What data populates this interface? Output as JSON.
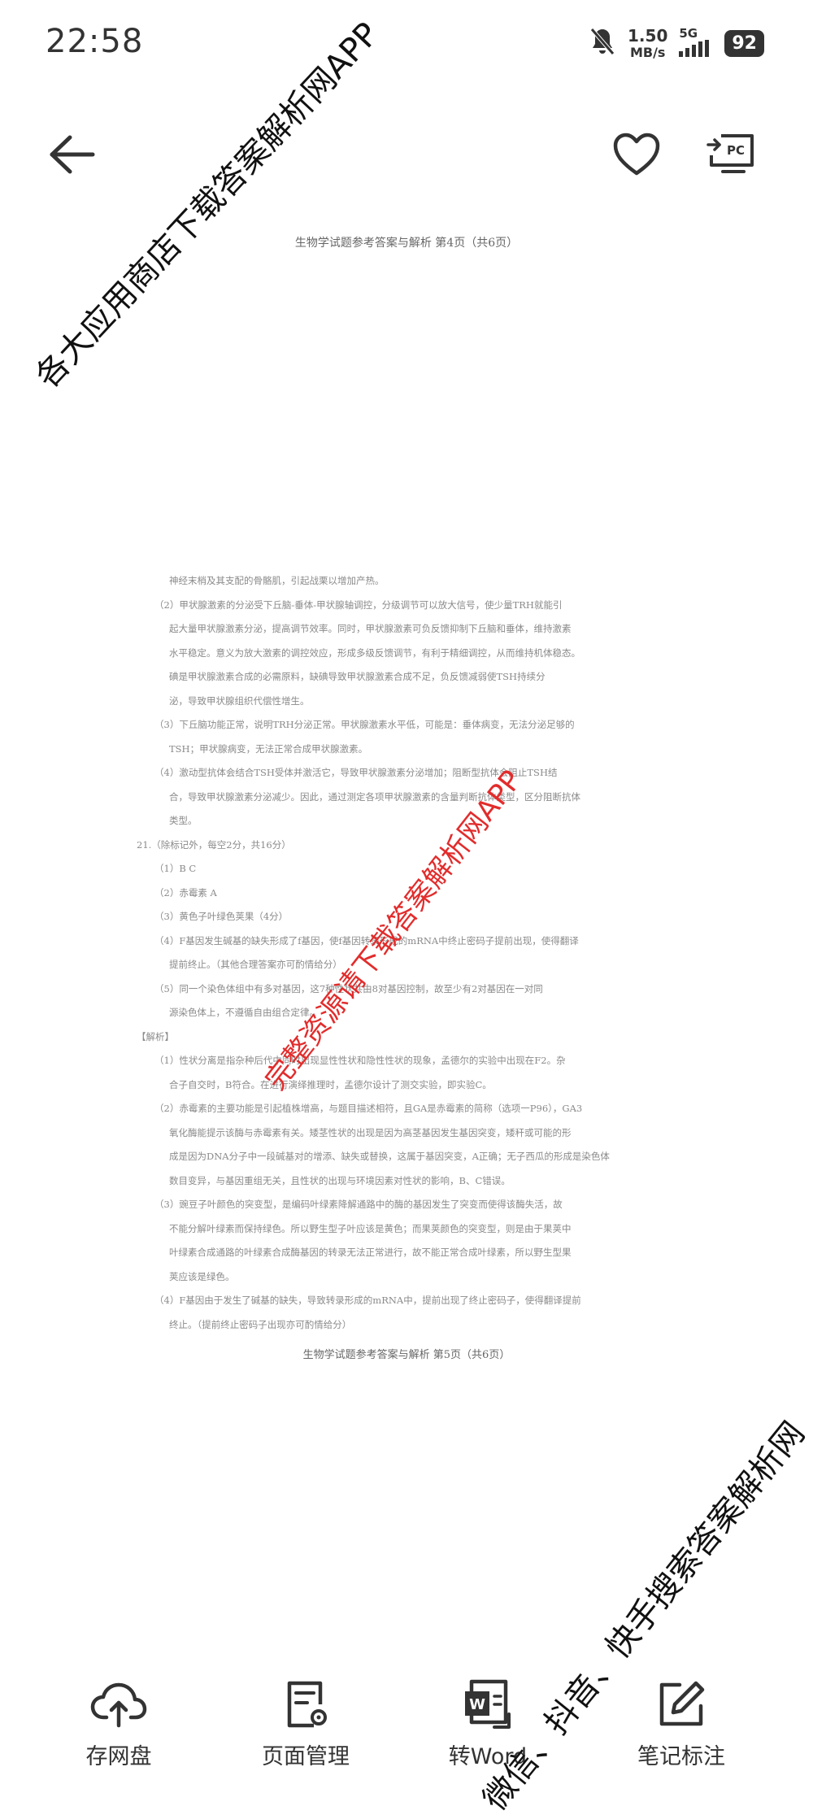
{
  "status_bar": {
    "time": "22:58",
    "speed_value": "1.50",
    "speed_unit": "MB/s",
    "network": "5G",
    "battery": "92",
    "icons": [
      "mute-icon",
      "signal-icon"
    ]
  },
  "app_bar": {
    "icons": [
      "back-arrow-icon",
      "heart-icon",
      "cast-to-pc-icon"
    ],
    "pc_label": "PC"
  },
  "document": {
    "top_caption": "生物学试题参考答案与解析 第4页（共6页）",
    "bottom_caption": "生物学试题参考答案与解析 第5页（共6页）",
    "lines": [
      "神经末梢及其支配的骨骼肌，引起战栗以增加产热。",
      "（2）甲状腺激素的分泌受下丘脑-垂体-甲状腺轴调控，分级调节可以放大信号，使少量TRH就能引",
      "起大量甲状腺激素分泌，提高调节效率。同时，甲状腺激素可负反馈抑制下丘脑和垂体，维持激素",
      "水平稳定。意义为放大激素的调控效应，形成多级反馈调节，有利于精细调控，从而维持机体稳态。",
      "碘是甲状腺激素合成的必需原料，缺碘导致甲状腺激素合成不足，负反馈减弱使TSH持续分",
      "泌，导致甲状腺组织代偿性增生。",
      "（3）下丘脑功能正常，说明TRH分泌正常。甲状腺激素水平低，可能是：垂体病变，无法分泌足够的",
      "TSH；甲状腺病变，无法正常合成甲状腺激素。",
      "（4）激动型抗体会结合TSH受体并激活它，导致甲状腺激素分泌增加；阻断型抗体会阻止TSH结",
      "合，导致甲状腺激素分泌减少。因此，通过测定各项甲状腺激素的含量判断抗体类型，区分阻断抗体",
      "类型。",
      "21.（除标记外，每空2分，共16分）",
      "（1）B C",
      "（2）赤霉素 A",
      "（3）黄色子叶绿色荚果（4分）",
      "（4）F基因发生碱基的缺失形成了f基因，使f基因转录形成的mRNA中终止密码子提前出现，使得翻译",
      "提前终止。（其他合理答案亦可酌情给分）",
      "（5）同一个染色体组中有多对基因，这7种性状共由8对基因控制，故至少有2对基因在一对同",
      "源染色体上，不遵循自由组合定律。",
      "【解析】",
      "（1）性状分离是指杂种后代中同时出现显性性状和隐性性状的现象，孟德尔的实验中出现在F2。杂",
      "合子自交时，B符合。在进行演绎推理时，孟德尔设计了测交实验，即实验C。",
      "（2）赤霉素的主要功能是引起植株增高，与题目描述相符，且GA是赤霉素的简称（选项一P96），GA3",
      "氧化酶能提示该酶与赤霉素有关。矮茎性状的出现是因为高茎基因发生基因突变，矮秆或可能的形",
      "成是因为DNA分子中一段碱基对的增添、缺失或替换，这属于基因突变，A正确；无子西瓜的形成是染色体",
      "数目变异，与基因重组无关，且性状的出现与环境因素对性状的影响，B、C错误。",
      "（3）豌豆子叶颜色的突变型，是编码叶绿素降解通路中的酶的基因发生了突变而使得该酶失活，故",
      "不能分解叶绿素而保持绿色。所以野生型子叶应该是黄色；而果荚颜色的突变型，则是由于果荚中",
      "叶绿素合成通路的叶绿素合成酶基因的转录无法正常进行，故不能正常合成叶绿素，所以野生型果",
      "荚应该是绿色。",
      "（4）F基因由于发生了碱基的缺失，导致转录形成的mRNA中，提前出现了终止密码子，使得翻译提前",
      "终止。（提前终止密码子出现亦可酌情给分）"
    ]
  },
  "watermarks": {
    "top_left": "各大应用商店下载答案解析网APP",
    "center": "完整资源请下载答案解析网APP",
    "bottom_right": "微信、抖音、快手搜索答案解析网"
  },
  "toolbar": {
    "items": [
      {
        "label": "存网盘",
        "icon": "cloud-upload-icon"
      },
      {
        "label": "页面管理",
        "icon": "page-settings-icon"
      },
      {
        "label": "转Word",
        "icon": "word-convert-icon"
      },
      {
        "label": "笔记标注",
        "icon": "edit-note-icon"
      }
    ]
  }
}
